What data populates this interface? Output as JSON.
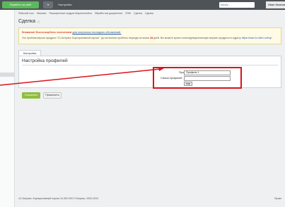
{
  "topbar": {
    "site_button": "Перейти на сайт",
    "dropdown_label": "▾",
    "settings_label": "Настройки",
    "search_placeholder": "поиск...",
    "user_name": "Иван Иванов"
  },
  "breadcrumbs": [
    "Рабочий стол",
    "Магазин",
    "Расширенные модули Маркетплейса",
    "Обработчик документов",
    "CRM",
    "Сделка",
    "Сделка"
  ],
  "page": {
    "title": "Сделка"
  },
  "warning": {
    "line1_text": "Внимание! Воспользуйтесь почечением",
    "line1_link": "для получения последних обновлений.",
    "line2_prefix": "Это пробная версия продукта \"1С-Битрикс: Корпоративный портал\". До истечения пробного периода осталось",
    "line2_days": "24",
    "line2_suffix": "дней. Вы можете купить полнофункциональную версию продукта по адресу",
    "line2_link": "https://www.1c-bitrix.ru/buy/"
  },
  "tabs": [
    {
      "label": "Настройка профилей"
    }
  ],
  "panel": {
    "title": "Настройка профилей"
  },
  "form": {
    "profile_label": "Профиль:",
    "profile_value": "Профиль 1",
    "list_label": "Список профилей:",
    "more_button": "еще"
  },
  "buttons": {
    "save": "Сохранить",
    "apply": "Применить"
  },
  "sidebar": {
    "items": [
      "",
      "",
      "",
      "",
      ""
    ]
  },
  "footer": {
    "copyright": "1С-Битрикс: Корпоративный портал 24.300.000 © Битрикс, 2002-2024",
    "right_text": "Прове"
  },
  "colors": {
    "topbar": "#4e5358",
    "accent_green": "#5cb85c",
    "save_green": "#8ebd3c",
    "highlight_red": "#d9141b",
    "warning_red": "#cc0000"
  }
}
